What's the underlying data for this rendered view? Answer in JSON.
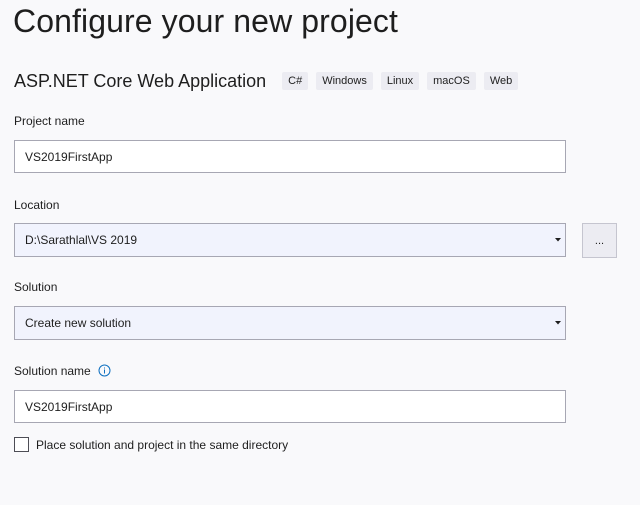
{
  "header": {
    "title": "Configure your new project"
  },
  "template": {
    "name": "ASP.NET Core Web Application",
    "tags": [
      "C#",
      "Windows",
      "Linux",
      "macOS",
      "Web"
    ]
  },
  "project_name": {
    "label": "Project name",
    "value": "VS2019FirstApp"
  },
  "location": {
    "label": "Location",
    "value": "D:\\Sarathlal\\VS 2019",
    "browse_label": "..."
  },
  "solution": {
    "label": "Solution",
    "value": "Create new solution"
  },
  "solution_name": {
    "label": "Solution name",
    "value": "VS2019FirstApp",
    "info_icon": "info-icon"
  },
  "same_directory": {
    "label": "Place solution and project in the same directory",
    "checked": false
  },
  "colors": {
    "background": "#f9f9fb",
    "combo_background": "#f1f3fd",
    "border": "#a7a7b3",
    "info_blue": "#0e70c0"
  }
}
